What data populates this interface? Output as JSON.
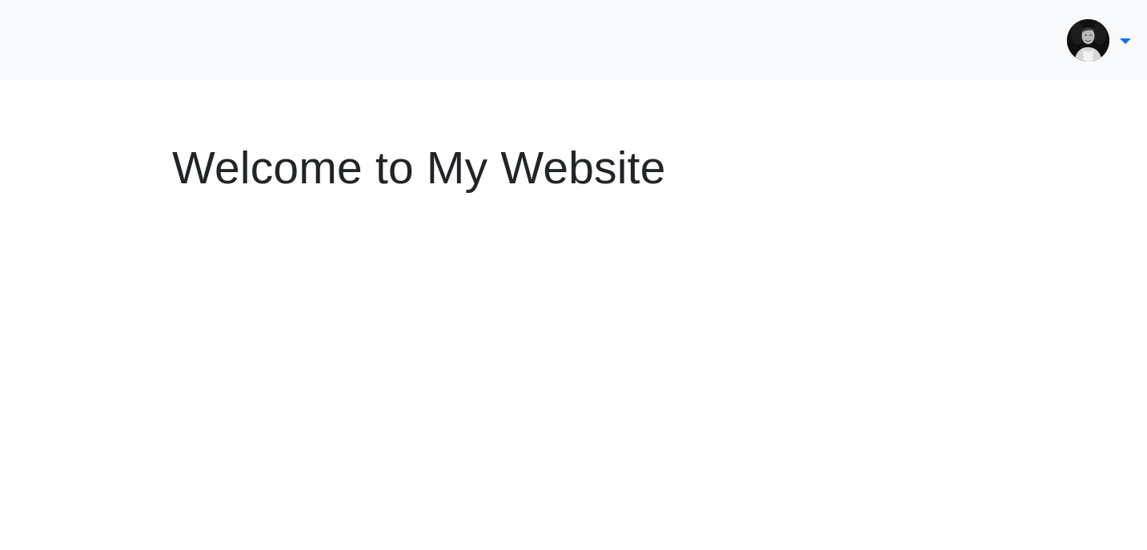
{
  "header": {
    "profile": {
      "avatar_icon": "user-avatar-photo",
      "dropdown_icon": "caret-down-icon",
      "caret_color": "#0d6efd"
    }
  },
  "main": {
    "title": "Welcome to My Website"
  },
  "colors": {
    "navbar_background": "#f8f9fa",
    "page_background": "#ffffff",
    "text": "#212529"
  }
}
